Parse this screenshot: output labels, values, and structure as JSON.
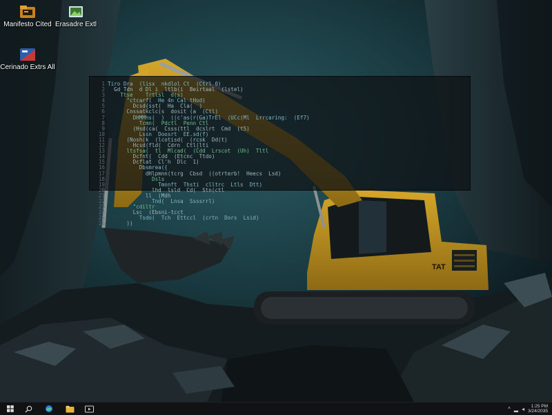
{
  "desktop": {
    "icons": [
      {
        "label": "Manifesto Cited",
        "icon": "folder-app-icon"
      },
      {
        "label": "Erasadre Extl",
        "icon": "image-viewer-icon"
      },
      {
        "label": "Cerinado Extrs All",
        "icon": "media-player-icon"
      }
    ]
  },
  "terminal": {
    "lines": [
      "Tiro Dra  (lisx  nkdlol Ct  (Ctrl 0)",
      "  Gd Tdn  d Dl i  ltlb(i  Beirtaal  (lstel)",
      "    Ttse    Trtlsl  d(s)",
      "      \"ctcarf(  He 4n Cal tHod)",
      "        Dcsd{sst(  Ha  Cla(  )",
      "      Cnssatkclc(s  dosit (a  (Ctl)",
      "        DHMMhs(  )  ((c'as(r(Ga)TrEl  (UCc(Ml  Lrrcaring:  (Ef7)",
      "          Tcmn(  Pdctl  Penn Ctl",
      "        (Hsd(ca(  Csss(ttl  dcslrt  Cmd  (t5)",
      "          Lssn  Doosrt  EE.sd(f)",
      "      (Nosh(k  (lcotisd(  (rcsk  Dd(t)",
      "        Hcsd(fld(  Cdrn  Ctl(lti",
      "      ltsfsa(  tl  Mlcad(  (Cdd  Lrscot  (Uh)  Tltl",
      "        Dcfnt(  Cdd  (Etcnc  Ttdo)",
      "        Dcflat  Cl'h  Dlc  1)",
      "          Dbsmrea({",
      "            dHlpmnn(tcrg  Cbsd  ((otrterb!  Heecs  Lsd)",
      "              Dsls",
      "                Tmnnft  Thsti  clltrc  Ltls  Dtt)",
      "              lhd  lsld  Cd(  Stn(ctl",
      "            ll  (Mdh",
      "              Tnd(  Lnsa  Ssssrrl)",
      "        \"cdiltr",
      "        Lsc  (Ebsni-tcct",
      "          Tsdo(  Tch  Ettccl  (crtn  Dors  Lsid)",
      "      ))"
    ]
  },
  "taskbar": {
    "buttons": [
      {
        "name": "start-button",
        "icon": "windows-logo-icon"
      },
      {
        "name": "search-button",
        "icon": "search-icon"
      },
      {
        "name": "edge-button",
        "icon": "browser-icon"
      },
      {
        "name": "file-explorer-button",
        "icon": "folder-icon"
      },
      {
        "name": "media-button",
        "icon": "media-icon"
      }
    ],
    "tray": {
      "chevron": "^",
      "network": "▂",
      "volume": "◂",
      "time": "1:25 PM",
      "date": "3/24/2035"
    }
  },
  "colors": {
    "excavator_body": "#c89a1e",
    "sky_teal": "#1f4a52",
    "taskbar": "#101214"
  }
}
